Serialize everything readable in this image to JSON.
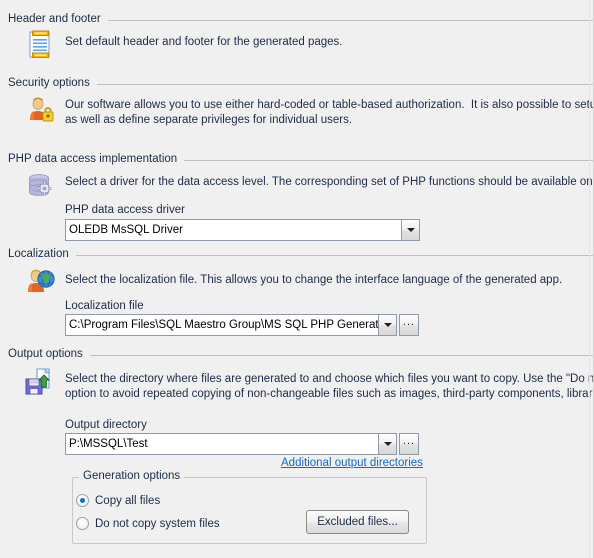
{
  "colors": {
    "background": "#f0f0f0",
    "text": "#1d2b47",
    "link": "#1569c7",
    "field_border": "#8e9aa8",
    "rule": "#bfbfbf",
    "radio_accent": "#1a6fc4"
  },
  "sections": {
    "header_footer": {
      "title": "Header and footer",
      "icon": "document-lines-icon",
      "description": "Set default header and footer for the generated pages."
    },
    "security": {
      "title": "Security options",
      "icon": "user-lock-icon",
      "description_line1": "Our software allows you to use either hard-coded or table-based authorization.  It is also possible to setup ro",
      "description_line2": "as well as define separate privileges for individual users."
    },
    "php_data_access": {
      "title": "PHP data access implementation",
      "icon": "database-gear-icon",
      "description": "Select a driver for the data access level. The corresponding set of PHP functions should be available on your",
      "driver_label": "PHP data access driver",
      "driver_value": "OLEDB MsSQL Driver"
    },
    "localization": {
      "title": "Localization",
      "icon": "user-globe-icon",
      "description": "Select the localization file. This allows you to change the interface language of the generated app.",
      "file_label": "Localization file",
      "file_value": "C:\\Program Files\\SQL Maestro Group\\MS SQL PHP Generator Pro",
      "browse_label": "..."
    },
    "output": {
      "title": "Output options",
      "icon": "save-page-icon",
      "description_line1": "Select the directory where files are generated to and choose which files you want to copy. Use the \"Do not c",
      "description_line2": "option to avoid repeated copying of non-changeable files such as images, third-party components, libraries a",
      "directory_label": "Output directory",
      "directory_value": "P:\\MSSQL\\Test",
      "browse_label": "...",
      "additional_link": "Additional output directories",
      "generation": {
        "title": "Generation options",
        "options": [
          {
            "label": "Copy all files",
            "checked": true
          },
          {
            "label": "Do not copy system files",
            "checked": false
          }
        ],
        "excluded_button": "Excluded files..."
      }
    }
  }
}
